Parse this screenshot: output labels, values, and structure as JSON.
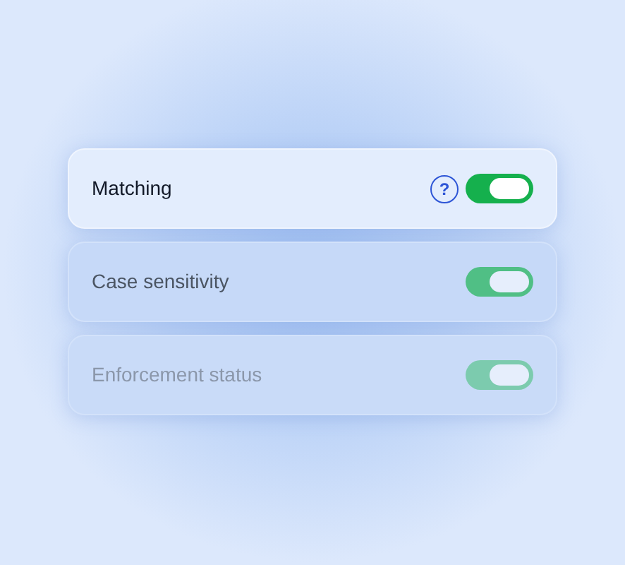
{
  "settings": [
    {
      "label": "Matching",
      "help": "?",
      "on": true,
      "selected": true,
      "disabled": false
    },
    {
      "label": "Case sensitivity",
      "on": true,
      "selected": false,
      "disabled": false
    },
    {
      "label": "Enforcement status",
      "on": true,
      "selected": false,
      "disabled": true
    }
  ]
}
